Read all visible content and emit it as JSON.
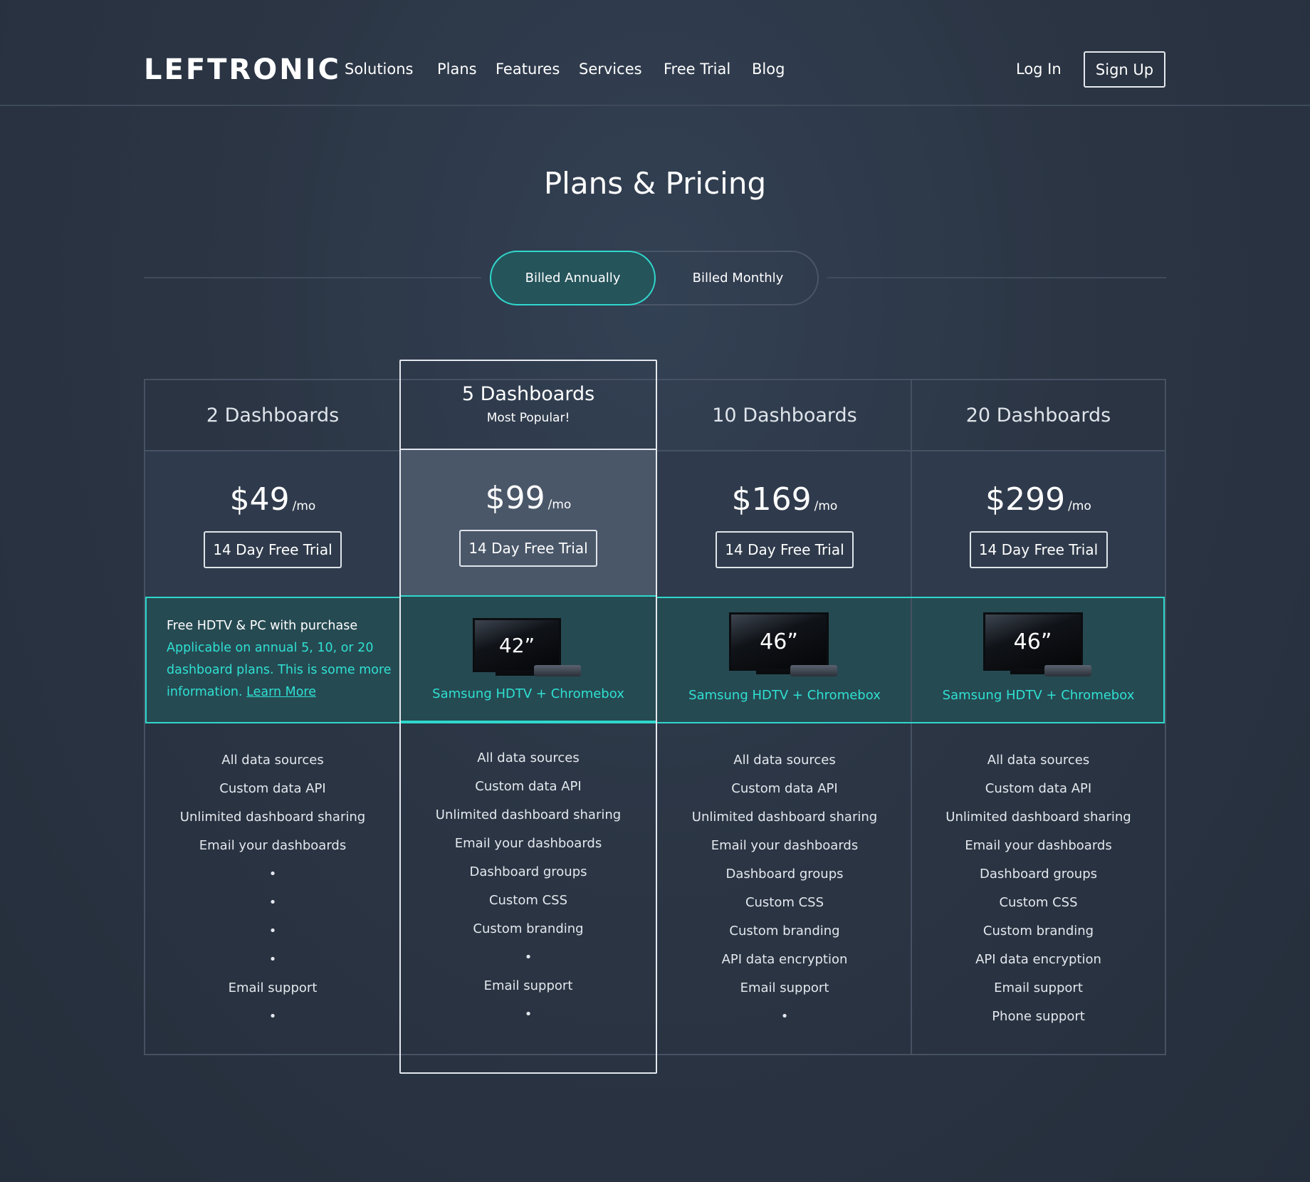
{
  "brand": {
    "logo": "LEFTRONIC"
  },
  "nav": {
    "items": [
      "Solutions",
      "Plans",
      "Features",
      "Services",
      "Free Trial",
      "Blog"
    ],
    "login": "Log In",
    "signup": "Sign Up"
  },
  "page": {
    "title": "Plans & Pricing"
  },
  "billing": {
    "annually": "Billed Annually",
    "monthly": "Billed Monthly",
    "selected": "annually"
  },
  "colors": {
    "accent": "#2fd8cc",
    "background": "#2b3544",
    "promo_bg": "#264a52"
  },
  "promo": {
    "headline": "Free HDTV & PC with purchase",
    "details": "Applicable on annual 5, 10, or 20 dashboard plans. This is some more information.",
    "link": "Learn More"
  },
  "plans": [
    {
      "name": "2 Dashboards",
      "price": "$49",
      "period": "/mo",
      "cta": "14 Day Free Trial",
      "features": [
        "All data sources",
        "Custom data API",
        "Unlimited dashboard sharing",
        "Email your dashboards",
        "•",
        "•",
        "•",
        "•",
        "Email support",
        "•"
      ]
    },
    {
      "name": "5 Dashboards",
      "subtitle": "Most Popular!",
      "price": "$99",
      "period": "/mo",
      "cta": "14 Day Free Trial",
      "tv_size": "42”",
      "bundle": "Samsung HDTV + Chromebox",
      "features": [
        "All data sources",
        "Custom data API",
        "Unlimited dashboard sharing",
        "Email your dashboards",
        "Dashboard groups",
        "Custom CSS",
        "Custom branding",
        "•",
        "Email support",
        "•"
      ]
    },
    {
      "name": "10 Dashboards",
      "price": "$169",
      "period": "/mo",
      "cta": "14 Day Free Trial",
      "tv_size": "46”",
      "bundle": "Samsung HDTV + Chromebox",
      "features": [
        "All data sources",
        "Custom data API",
        "Unlimited dashboard sharing",
        "Email your dashboards",
        "Dashboard groups",
        "Custom CSS",
        "Custom branding",
        "API data encryption",
        "Email support",
        "•"
      ]
    },
    {
      "name": "20 Dashboards",
      "price": "$299",
      "period": "/mo",
      "cta": "14 Day Free Trial",
      "tv_size": "46”",
      "bundle": "Samsung HDTV + Chromebox",
      "features": [
        "All data sources",
        "Custom data API",
        "Unlimited dashboard sharing",
        "Email your dashboards",
        "Dashboard groups",
        "Custom CSS",
        "Custom branding",
        "API data encryption",
        "Email support",
        "Phone support"
      ]
    }
  ]
}
